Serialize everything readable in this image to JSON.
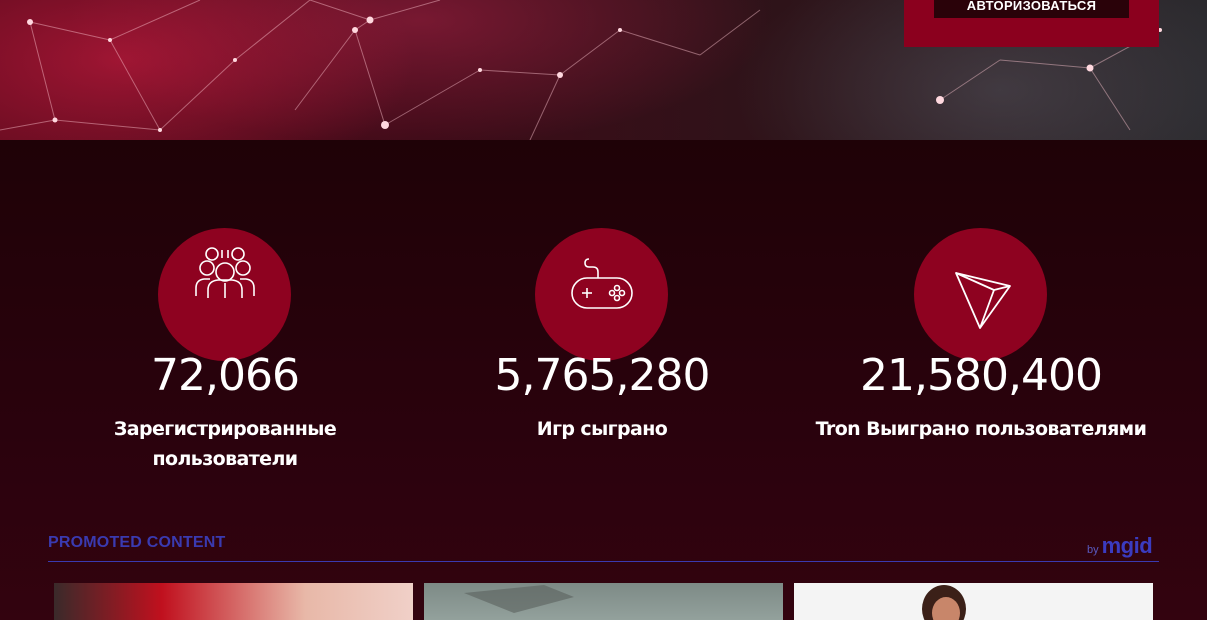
{
  "header": {
    "login_label": "АВТОРИЗОВАТЬСЯ"
  },
  "stats": [
    {
      "value": "72,066",
      "label": "Зарегистрированные пользователи",
      "icon": "users-group-icon"
    },
    {
      "value": "5,765,280",
      "label": "Игр сыграно",
      "icon": "gamepad-icon"
    },
    {
      "value": "21,580,400",
      "label": "Tron Выиграно пользователями",
      "icon": "tron-logo-icon"
    }
  ],
  "promo": {
    "title": "PROMOTED CONTENT",
    "by": "by",
    "brand": "mgid"
  },
  "colors": {
    "accent": "#8e0220",
    "background": "#24020c",
    "promo": "#3a3ab0"
  }
}
